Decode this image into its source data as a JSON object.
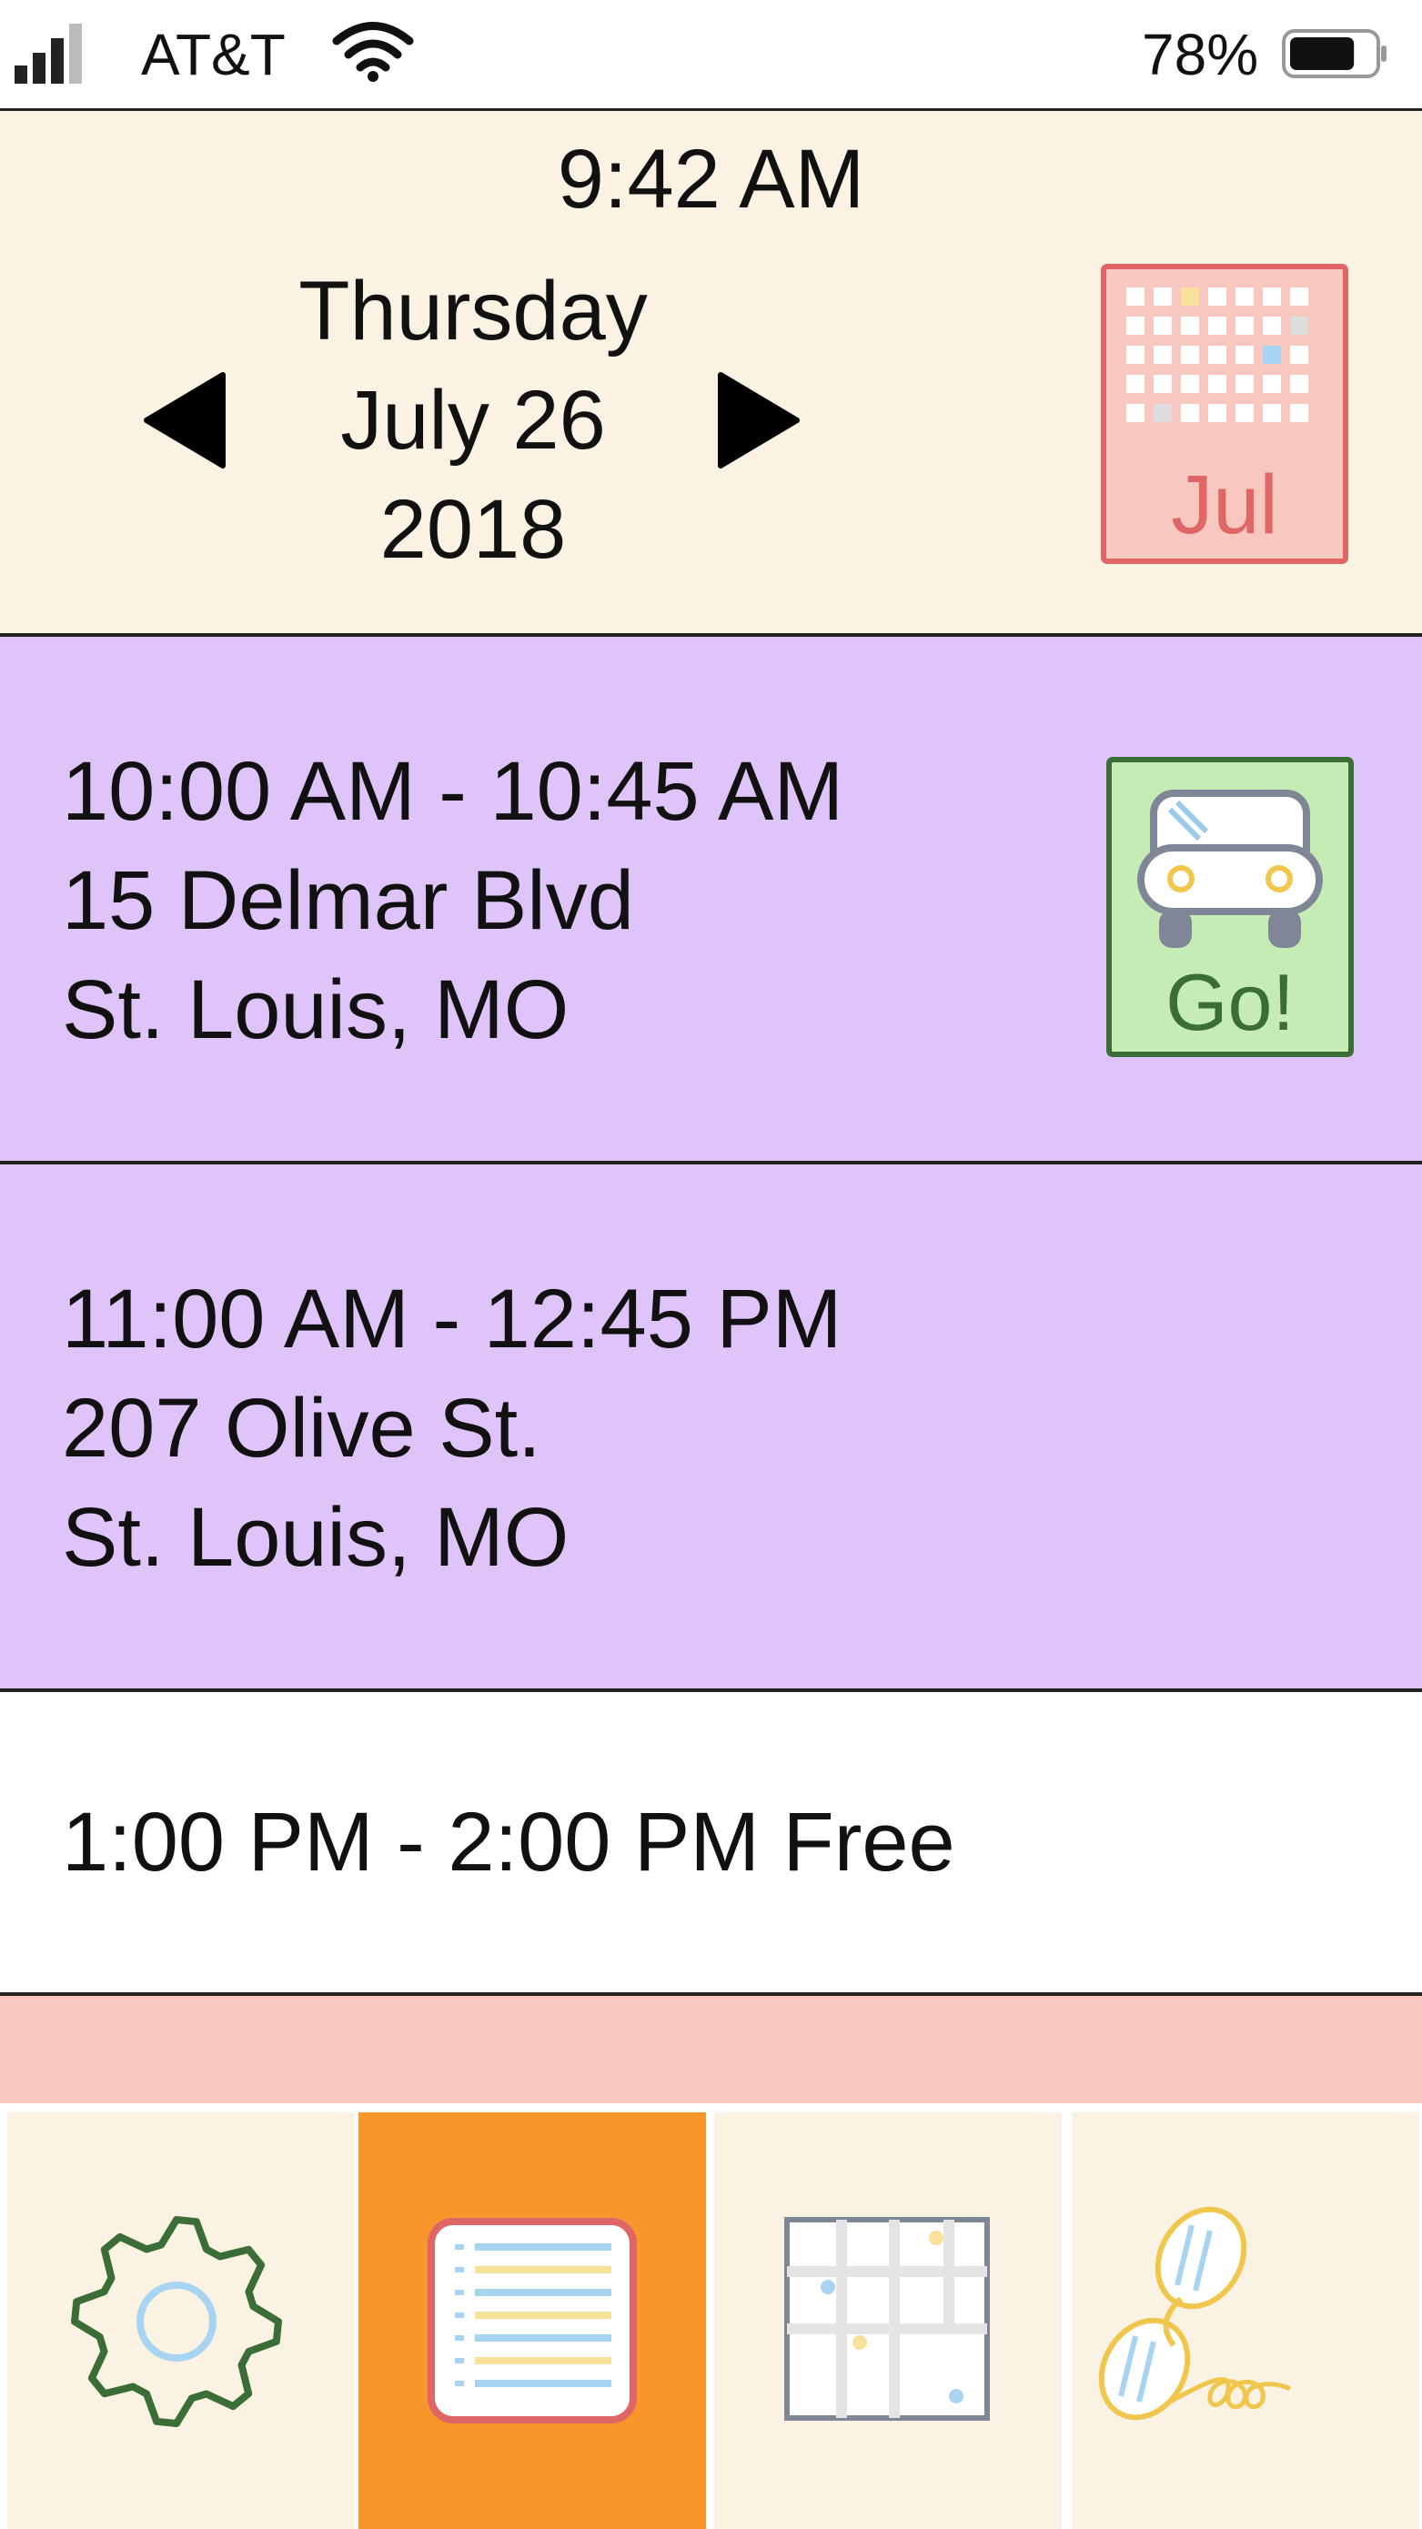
{
  "status_bar": {
    "carrier": "AT&T",
    "battery_percent": "78%",
    "signal_icon": "cellular-signal-icon",
    "wifi_icon": "wifi-icon",
    "battery_icon": "battery-icon",
    "battery_level": 0.78
  },
  "header": {
    "time": "9:42 AM",
    "weekday": "Thursday",
    "month_day": "July 26",
    "year": "2018",
    "calendar_button_label": "Jul",
    "prev_icon": "triangle-left-icon",
    "next_icon": "triangle-right-icon"
  },
  "appointments": [
    {
      "time": "10:00 AM - 10:45 AM",
      "street": "15 Delmar Blvd",
      "city": "St. Louis, MO",
      "go_button_label": "Go!",
      "go_icon": "car-icon"
    },
    {
      "time": "11:00 AM - 12:45 PM",
      "street": "207 Olive St.",
      "city": "St. Louis, MO"
    }
  ],
  "free_slot": {
    "text": "1:00 PM - 2:00 PM Free"
  },
  "tabs": [
    {
      "name": "settings",
      "icon": "gear-icon",
      "selected": false
    },
    {
      "name": "schedule",
      "icon": "list-icon",
      "selected": true
    },
    {
      "name": "map",
      "icon": "map-icon",
      "selected": false
    },
    {
      "name": "phone",
      "icon": "phone-icon",
      "selected": false
    }
  ],
  "colors": {
    "header_bg": "#faf3e3",
    "appointment_bg": "#dec4f9",
    "go_button_bg": "#c5ecb4",
    "calendar_button_bg": "#f7c7c0",
    "selected_tab_bg": "#f7962b",
    "alert_strip": "#f7c7c0"
  }
}
